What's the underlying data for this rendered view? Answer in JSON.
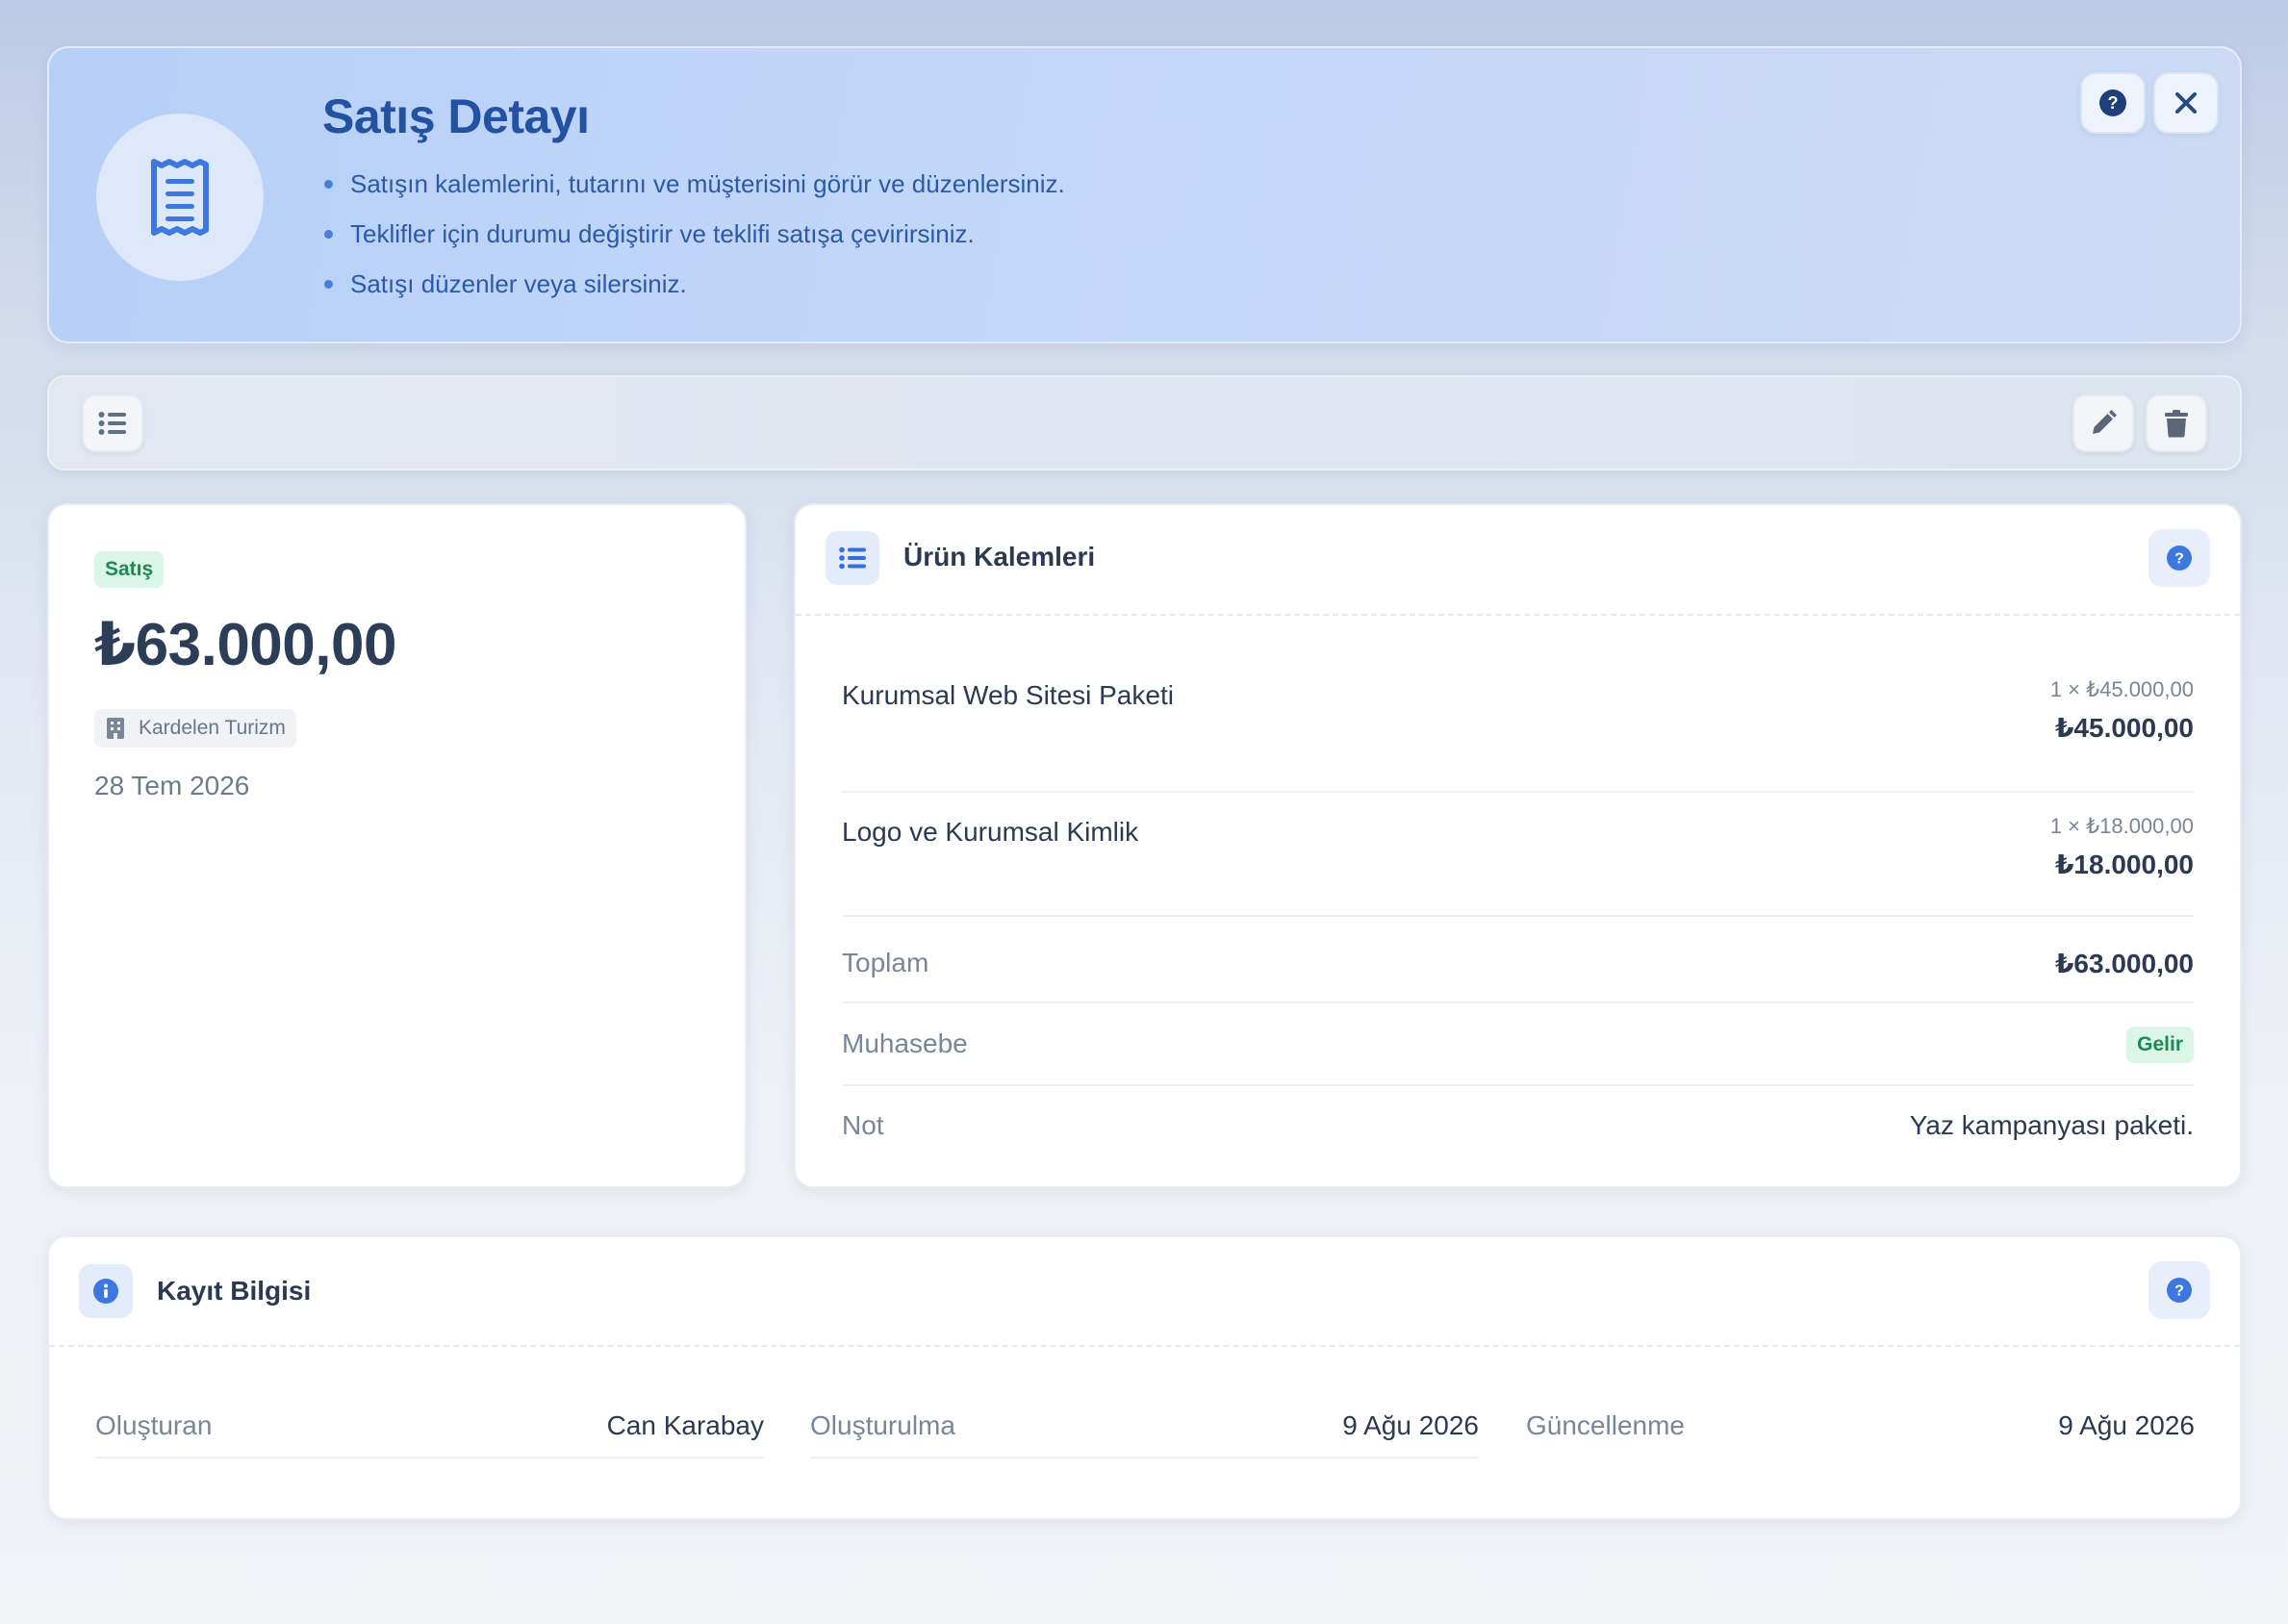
{
  "header": {
    "title": "Satış Detayı",
    "bullets": [
      "Satışın kalemlerini, tutarını ve müşterisini görür ve düzenlersiniz.",
      "Teklifler için durumu değiştirir ve teklifi satışa çevirirsiniz.",
      "Satışı düzenler veya silersiniz."
    ],
    "icons": {
      "avatar": "receipt-icon",
      "help": "question-circle-icon",
      "close": "close-icon"
    }
  },
  "toolbar": {
    "icons": {
      "list": "list-icon",
      "edit": "pencil-icon",
      "delete": "trash-icon"
    }
  },
  "summary": {
    "type_badge": "Satış",
    "amount": "₺63.000,00",
    "customer": "Kardelen Turizm",
    "customer_icon": "building-icon",
    "date": "28 Tem 2026"
  },
  "items": {
    "title": "Ürün Kalemleri",
    "rows": [
      {
        "name": "Kurumsal Web Sitesi Paketi",
        "qty": "1 × ₺45.000,00",
        "subtotal": "₺45.000,00"
      },
      {
        "name": "Logo ve Kurumsal Kimlik",
        "qty": "1 × ₺18.000,00",
        "subtotal": "₺18.000,00"
      }
    ],
    "total_label": "Toplam",
    "total_value": "₺63.000,00",
    "accounting_label": "Muhasebe",
    "accounting_value": "Gelir",
    "note_label": "Not",
    "note_value": "Yaz kampanyası paketi."
  },
  "record": {
    "title": "Kayıt Bilgisi",
    "fields": [
      {
        "label": "Oluşturan",
        "value": "Can Karabay"
      },
      {
        "label": "Oluşturulma",
        "value": "9 Ağu 2026"
      },
      {
        "label": "Güncellenme",
        "value": "9 Ağu 2026"
      }
    ]
  },
  "colors": {
    "accent": "#2352a3",
    "primary_icon": "#3c78e0",
    "success_bg": "#dcf5e9",
    "success_text": "#1c8a55",
    "text": "#2b3a52",
    "muted": "#7a8596"
  }
}
